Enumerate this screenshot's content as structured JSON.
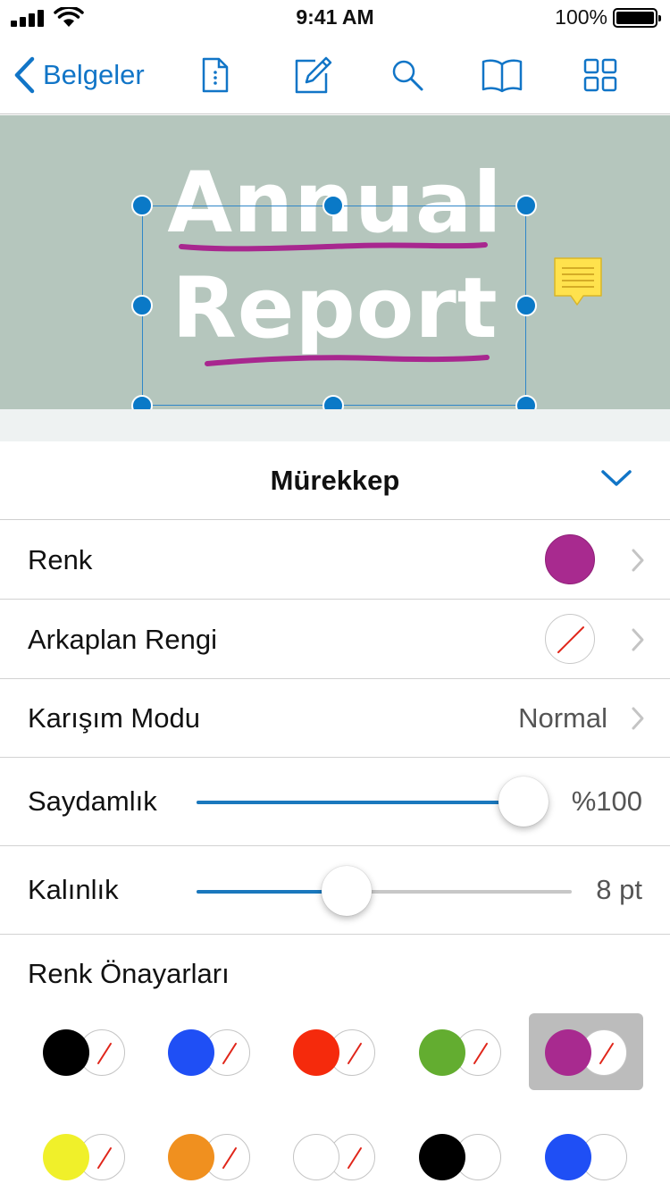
{
  "status_bar": {
    "time": "9:41 AM",
    "battery_percent": "100%"
  },
  "nav": {
    "back_label": "Belgeler",
    "icons": [
      "document-info-icon",
      "edit-icon",
      "search-icon",
      "book-icon",
      "grid-icon"
    ],
    "accent_color": "#1175c7"
  },
  "document": {
    "title_line_1": "Annual",
    "title_line_2": "Report",
    "background_color": "#b5c6bd",
    "ink_color": "#a8278f"
  },
  "panel": {
    "title": "Mürekkep",
    "rows": {
      "color": {
        "label": "Renk",
        "swatch": "#a82a8f"
      },
      "background": {
        "label": "Arkaplan Rengi",
        "swatch": "none"
      },
      "blend": {
        "label": "Karışım Modu",
        "value": "Normal"
      },
      "opacity": {
        "label": "Saydamlık",
        "value": "%100",
        "level": 1.0
      },
      "thickness": {
        "label": "Kalınlık",
        "value": "8 pt",
        "level": 0.4
      }
    },
    "presets_label": "Renk Önayarları",
    "presets": [
      {
        "stroke": "#000000",
        "fill": "none",
        "selected": false
      },
      {
        "stroke": "#1f4ff5",
        "fill": "none",
        "selected": false
      },
      {
        "stroke": "#f52a0c",
        "fill": "none",
        "selected": false
      },
      {
        "stroke": "#63ad30",
        "fill": "none",
        "selected": false
      },
      {
        "stroke": "#a82a8f",
        "fill": "none",
        "selected": true
      },
      {
        "stroke": "#f0f02a",
        "fill": "none",
        "selected": false
      },
      {
        "stroke": "#f0901f",
        "fill": "none",
        "selected": false
      },
      {
        "stroke": "#ffffff",
        "fill": "none",
        "selected": false
      },
      {
        "stroke": "#000000",
        "fill": "#ffffff",
        "selected": false
      },
      {
        "stroke": "#1f4ff5",
        "fill": "#ffffff",
        "selected": false
      }
    ]
  }
}
